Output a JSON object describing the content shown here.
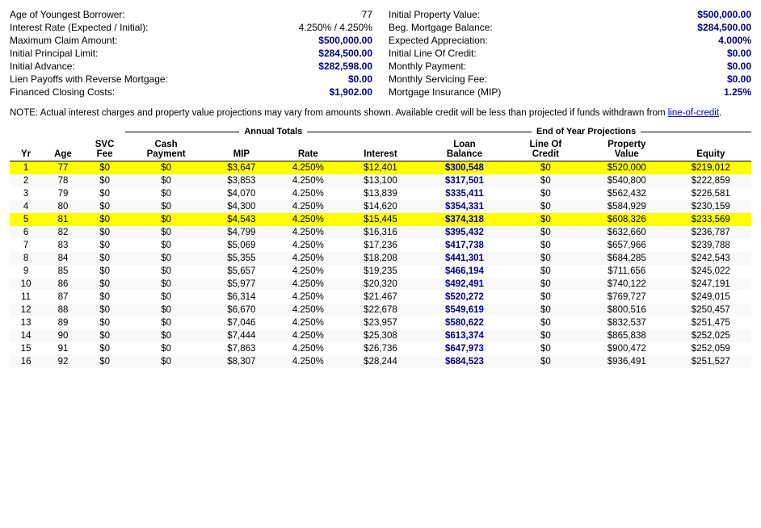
{
  "info_left": [
    {
      "label": "Age of Youngest Borrower:",
      "value": "77",
      "bold": false
    },
    {
      "label": "Interest Rate (Expected / Initial):",
      "value": "4.250%  /  4.250%",
      "bold": false
    },
    {
      "label": "Maximum Claim Amount:",
      "value": "$500,000.00",
      "bold": true
    },
    {
      "label": "Initial Principal Limit:",
      "value": "$284,500.00",
      "bold": true
    },
    {
      "label": "Initial Advance:",
      "value": "$282,598.00",
      "bold": true
    },
    {
      "label": "Lien Payoffs with Reverse Mortgage:",
      "value": "$0.00",
      "bold": true
    },
    {
      "label": "Financed Closing Costs:",
      "value": "$1,902.00",
      "bold": true
    }
  ],
  "info_right": [
    {
      "label": "Initial Property Value:",
      "value": "$500,000.00",
      "bold": true
    },
    {
      "label": "Beg. Mortgage Balance:",
      "value": "$284,500.00",
      "bold": true
    },
    {
      "label": "Expected Appreciation:",
      "value": "4.000%",
      "bold": true
    },
    {
      "label": "Initial Line Of Credit:",
      "value": "$0.00",
      "bold": true
    },
    {
      "label": "Monthly Payment:",
      "value": "$0.00",
      "bold": true
    },
    {
      "label": "Monthly Servicing Fee:",
      "value": "$0.00",
      "bold": true
    },
    {
      "label": "Mortgage Insurance (MIP)",
      "value": "1.25%",
      "bold": true
    }
  ],
  "note": "NOTE:  Actual interest charges and property value projections may vary from amounts shown.  Available credit will be less than projected if funds withdrawn from line-of-credit.",
  "note_link": "line-of-credit",
  "table": {
    "annual_header": "Annual Totals",
    "eoy_header": "End of Year Projections",
    "columns": [
      "Yr",
      "Age",
      "SVC\nFee",
      "Cash\nPayment",
      "MIP",
      "Rate",
      "Interest",
      "Loan\nBalance",
      "Line Of\nCredit",
      "Property\nValue",
      "Equity"
    ],
    "rows": [
      {
        "yr": 1,
        "age": 77,
        "svc": "$0",
        "cash": "$0",
        "mip": "$3,647",
        "rate": "4.250%",
        "interest": "$12,401",
        "loan": "$300,548",
        "loc": "$0",
        "prop": "$520,000",
        "equity": "$219,012",
        "highlight": true
      },
      {
        "yr": 2,
        "age": 78,
        "svc": "$0",
        "cash": "$0",
        "mip": "$3,853",
        "rate": "4.250%",
        "interest": "$13,100",
        "loan": "$317,501",
        "loc": "$0",
        "prop": "$540,800",
        "equity": "$222,859",
        "highlight": false
      },
      {
        "yr": 3,
        "age": 79,
        "svc": "$0",
        "cash": "$0",
        "mip": "$4,070",
        "rate": "4.250%",
        "interest": "$13,839",
        "loan": "$335,411",
        "loc": "$0",
        "prop": "$562,432",
        "equity": "$226,581",
        "highlight": false
      },
      {
        "yr": 4,
        "age": 80,
        "svc": "$0",
        "cash": "$0",
        "mip": "$4,300",
        "rate": "4.250%",
        "interest": "$14,620",
        "loan": "$354,331",
        "loc": "$0",
        "prop": "$584,929",
        "equity": "$230,159",
        "highlight": false
      },
      {
        "yr": 5,
        "age": 81,
        "svc": "$0",
        "cash": "$0",
        "mip": "$4,543",
        "rate": "4.250%",
        "interest": "$15,445",
        "loan": "$374,318",
        "loc": "$0",
        "prop": "$608,326",
        "equity": "$233,569",
        "highlight": true
      },
      {
        "yr": 6,
        "age": 82,
        "svc": "$0",
        "cash": "$0",
        "mip": "$4,799",
        "rate": "4.250%",
        "interest": "$16,316",
        "loan": "$395,432",
        "loc": "$0",
        "prop": "$632,660",
        "equity": "$236,787",
        "highlight": false
      },
      {
        "yr": 7,
        "age": 83,
        "svc": "$0",
        "cash": "$0",
        "mip": "$5,069",
        "rate": "4.250%",
        "interest": "$17,236",
        "loan": "$417,738",
        "loc": "$0",
        "prop": "$657,966",
        "equity": "$239,788",
        "highlight": false
      },
      {
        "yr": 8,
        "age": 84,
        "svc": "$0",
        "cash": "$0",
        "mip": "$5,355",
        "rate": "4.250%",
        "interest": "$18,208",
        "loan": "$441,301",
        "loc": "$0",
        "prop": "$684,285",
        "equity": "$242,543",
        "highlight": false
      },
      {
        "yr": 9,
        "age": 85,
        "svc": "$0",
        "cash": "$0",
        "mip": "$5,657",
        "rate": "4.250%",
        "interest": "$19,235",
        "loan": "$466,194",
        "loc": "$0",
        "prop": "$711,656",
        "equity": "$245,022",
        "highlight": false
      },
      {
        "yr": 10,
        "age": 86,
        "svc": "$0",
        "cash": "$0",
        "mip": "$5,977",
        "rate": "4.250%",
        "interest": "$20,320",
        "loan": "$492,491",
        "loc": "$0",
        "prop": "$740,122",
        "equity": "$247,191",
        "highlight": false
      },
      {
        "yr": 11,
        "age": 87,
        "svc": "$0",
        "cash": "$0",
        "mip": "$6,314",
        "rate": "4.250%",
        "interest": "$21,467",
        "loan": "$520,272",
        "loc": "$0",
        "prop": "$769,727",
        "equity": "$249,015",
        "highlight": false
      },
      {
        "yr": 12,
        "age": 88,
        "svc": "$0",
        "cash": "$0",
        "mip": "$6,670",
        "rate": "4.250%",
        "interest": "$22,678",
        "loan": "$549,619",
        "loc": "$0",
        "prop": "$800,516",
        "equity": "$250,457",
        "highlight": false
      },
      {
        "yr": 13,
        "age": 89,
        "svc": "$0",
        "cash": "$0",
        "mip": "$7,046",
        "rate": "4.250%",
        "interest": "$23,957",
        "loan": "$580,622",
        "loc": "$0",
        "prop": "$832,537",
        "equity": "$251,475",
        "highlight": false
      },
      {
        "yr": 14,
        "age": 90,
        "svc": "$0",
        "cash": "$0",
        "mip": "$7,444",
        "rate": "4.250%",
        "interest": "$25,308",
        "loan": "$613,374",
        "loc": "$0",
        "prop": "$865,838",
        "equity": "$252,025",
        "highlight": false
      },
      {
        "yr": 15,
        "age": 91,
        "svc": "$0",
        "cash": "$0",
        "mip": "$7,863",
        "rate": "4.250%",
        "interest": "$26,736",
        "loan": "$647,973",
        "loc": "$0",
        "prop": "$900,472",
        "equity": "$252,059",
        "highlight": false
      },
      {
        "yr": 16,
        "age": 92,
        "svc": "$0",
        "cash": "$0",
        "mip": "$8,307",
        "rate": "4.250%",
        "interest": "$28,244",
        "loan": "$684,523",
        "loc": "$0",
        "prop": "$936,491",
        "equity": "$251,527",
        "highlight": false
      }
    ]
  }
}
